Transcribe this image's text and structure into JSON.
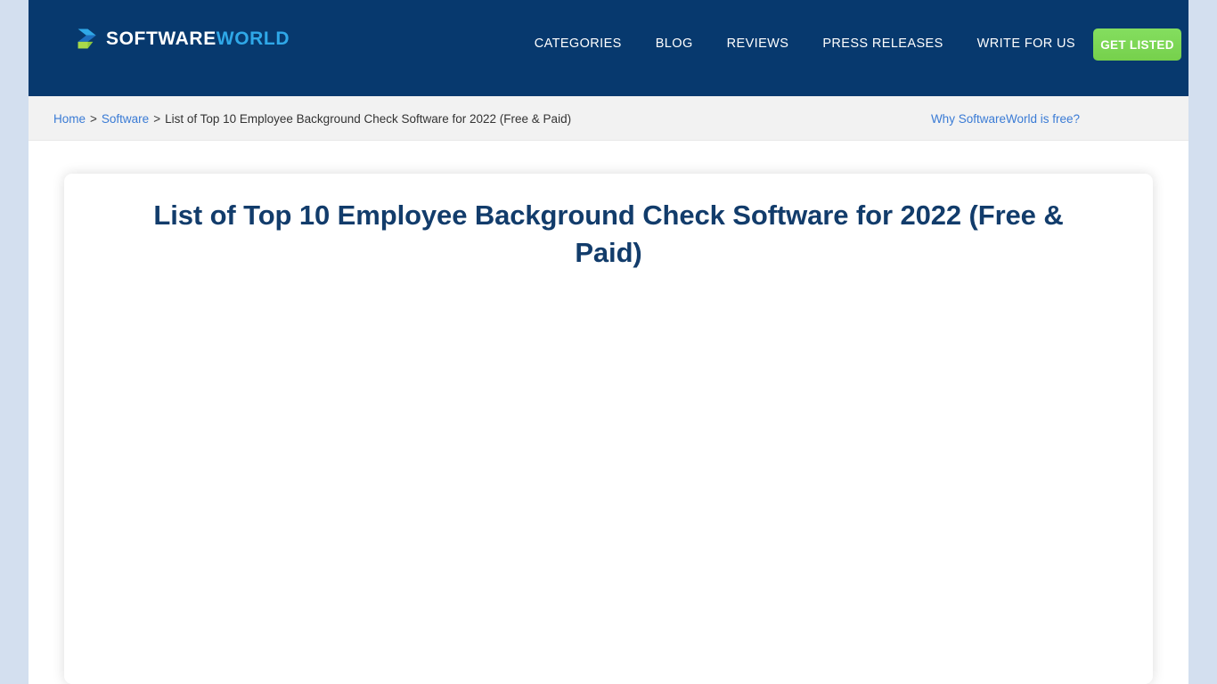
{
  "header": {
    "logo": {
      "icon": "chevron-arrow-logo-icon",
      "text_primary": "SOFTWARE",
      "text_secondary": "WORLD"
    },
    "nav_items": [
      {
        "label": "CATEGORIES",
        "name": "nav-item-categories"
      },
      {
        "label": "BLOG",
        "name": "nav-item-blog"
      },
      {
        "label": "REVIEWS",
        "name": "nav-item-reviews"
      },
      {
        "label": "PRESS RELEASES",
        "name": "nav-item-press-releases"
      },
      {
        "label": "WRITE FOR US",
        "name": "nav-item-write-for-us"
      }
    ],
    "cta_label": "GET LISTED",
    "background_color": "#07396e",
    "cta_color": "#7ed957"
  },
  "breadcrumb": {
    "home_label": "Home",
    "separator": ">",
    "software_label": "Software",
    "current_label": "List of Top 10 Employee Background Check Software for 2022 (Free & Paid)",
    "why_free_label": "Why SoftwareWorld is free?",
    "link_color": "#3a7bd5"
  },
  "article": {
    "title": "List of Top 10 Employee Background Check Software for 2022 (Free & Paid)",
    "title_color": "#123c6b"
  },
  "page": {
    "gutter_color": "#d3dfef",
    "background_color": "#ffffff"
  }
}
